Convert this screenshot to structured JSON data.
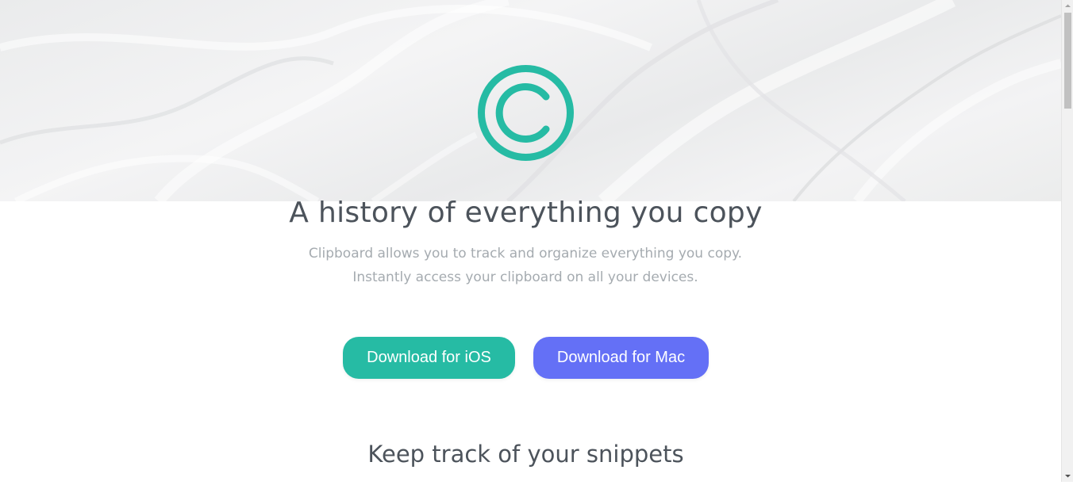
{
  "colors": {
    "accent_teal": "#26bba4",
    "accent_blue": "#6470f6",
    "heading": "#4c535b",
    "body_text": "#a5abb0"
  },
  "hero": {
    "logo_icon": "copyright-icon",
    "headline": "A history of everything you copy",
    "subtext": "Clipboard allows you to track and organize everything you copy. Instantly access your clipboard on all your devices."
  },
  "buttons": {
    "ios_label": "Download for iOS",
    "mac_label": "Download for Mac"
  },
  "section": {
    "title": "Keep track of your snippets"
  }
}
